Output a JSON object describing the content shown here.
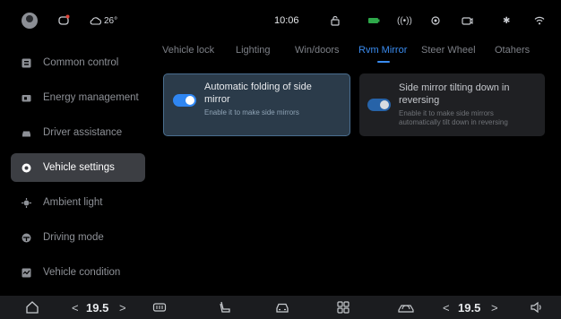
{
  "status_bar": {
    "temperature": "26°",
    "time": "10:06",
    "icons": [
      "avatar",
      "phone-notification-icon",
      "cloud-icon",
      "lock-icon",
      "battery-icon",
      "signal-icon",
      "location-icon",
      "camera-icon",
      "bluetooth-icon",
      "wifi-icon"
    ]
  },
  "sidebar": {
    "items": [
      {
        "label": "Common control",
        "icon": "grid-icon",
        "active": false
      },
      {
        "label": "Energy management",
        "icon": "battery-icon",
        "active": false
      },
      {
        "label": "Driver assistance",
        "icon": "car-icon",
        "active": false
      },
      {
        "label": "Vehicle settings",
        "icon": "settings-icon",
        "active": true
      },
      {
        "label": "Ambient light",
        "icon": "light-icon",
        "active": false
      },
      {
        "label": "Driving mode",
        "icon": "steering-icon",
        "active": false
      },
      {
        "label": "Vehicle condition",
        "icon": "diagnostics-icon",
        "active": false
      }
    ]
  },
  "tabs": [
    {
      "label": "Vehicle lock",
      "active": false
    },
    {
      "label": "Lighting",
      "active": false
    },
    {
      "label": "Win/doors",
      "active": false
    },
    {
      "label": "Rvm Mirror",
      "active": true
    },
    {
      "label": "Steer Wheel",
      "active": false
    },
    {
      "label": "Otahers",
      "active": false
    }
  ],
  "cards": [
    {
      "title_line1": "Automatic folding of side",
      "title_line2": "mirror",
      "desc_line1": "Enable it to make side mirrors",
      "enabled": true
    },
    {
      "title_line1": "Side mirror tilting down in",
      "title_line2": "reversing",
      "desc_line1": "Enable it to make side mirrors",
      "desc_line2": "automatically tilt down in reversing",
      "enabled": true
    }
  ],
  "dock": {
    "left_temp": "19.5",
    "right_temp": "19.5",
    "prev_symbol": "<",
    "next_symbol": ">"
  },
  "colors": {
    "accent": "#3a8cf0",
    "background": "#000000",
    "active_nav": "#3c3e43",
    "card_on": "#2b3b4a",
    "card_off": "#1f2023"
  }
}
